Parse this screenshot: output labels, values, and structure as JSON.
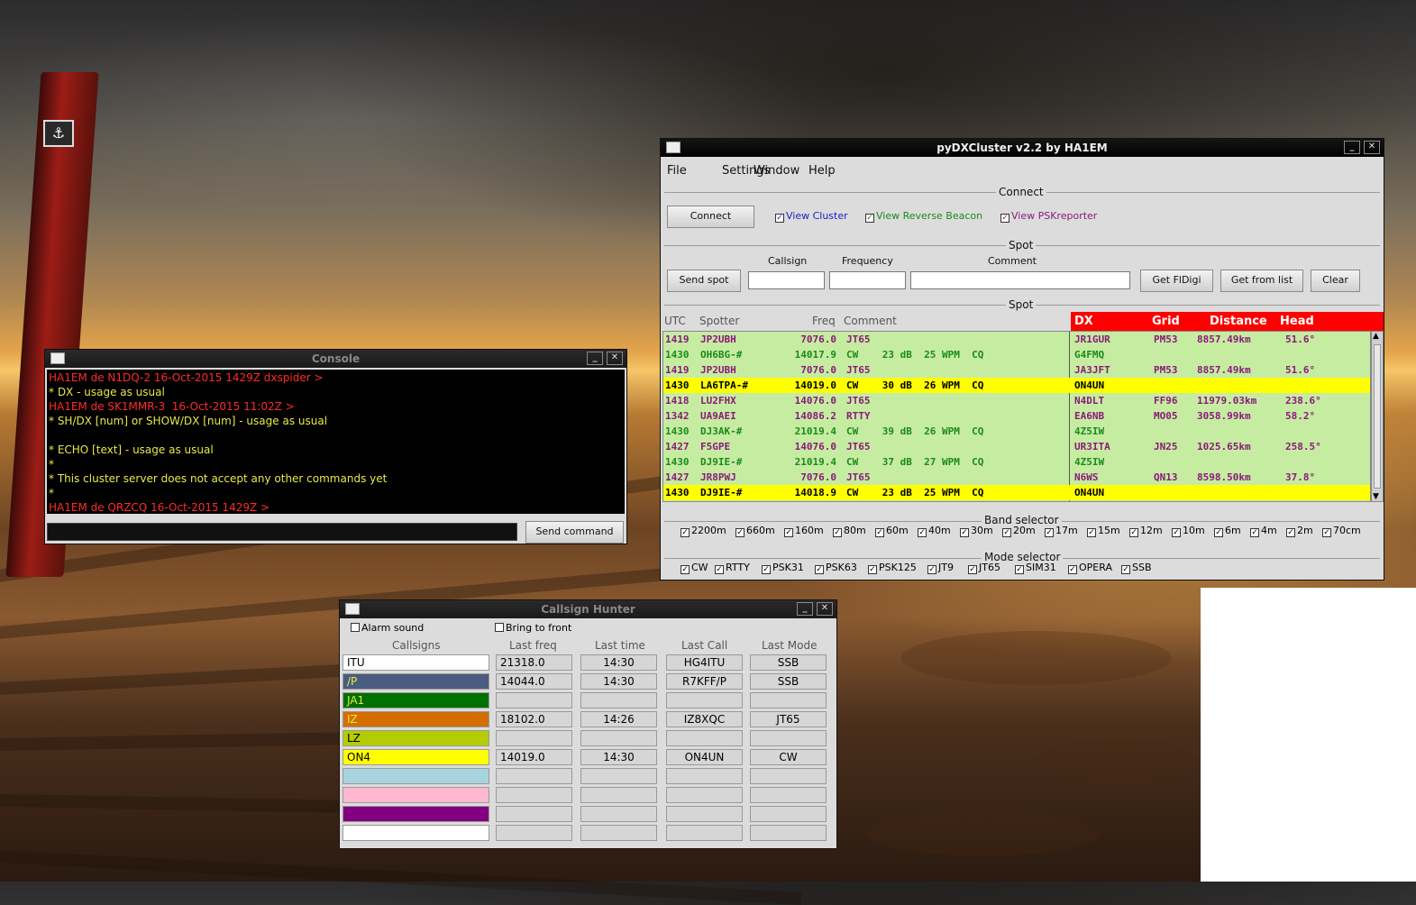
{
  "desktop": {
    "sign_glyph": "⚓"
  },
  "pydx": {
    "title": "pyDXCluster v2.2 by HA1EM",
    "menu": [
      "File",
      "Settings",
      "Window",
      "Help"
    ],
    "connect_group": "Connect",
    "connect_btn": "Connect",
    "view_cluster": "View Cluster",
    "view_beacon": "View Reverse Beacon",
    "view_psk": "View PSKreporter",
    "spot_group": "Spot",
    "send_spot": "Send spot",
    "callsign_label": "Callsign",
    "frequency_label": "Frequency",
    "comment_label": "Comment",
    "get_fldigi": "Get FlDigi",
    "get_from_list": "Get from list",
    "clear": "Clear",
    "spot_list_group": "Spot",
    "headers": {
      "utc": "UTC",
      "spotter": "Spotter",
      "freq": "Freq",
      "comment": "Comment",
      "dx": "DX",
      "grid": "Grid",
      "distance": "Distance",
      "head": "Head"
    },
    "spots": [
      {
        "utc": "1419",
        "spotter": "JP2UBH",
        "freq": "7076.0",
        "comment": "JT65",
        "dx": "JR1GUR",
        "grid": "PM53",
        "distance": "8857.49km",
        "head": "51.6°",
        "color": "#8a1a7a",
        "hl": false
      },
      {
        "utc": "1430",
        "spotter": "OH6BG-#",
        "freq": "14017.9",
        "comment": "CW    23 dB  25 WPM  CQ",
        "dx": "G4FMQ",
        "grid": "",
        "distance": "",
        "head": "",
        "color": "#1b8a1b",
        "hl": false
      },
      {
        "utc": "1419",
        "spotter": "JP2UBH",
        "freq": "7076.0",
        "comment": "JT65",
        "dx": "JA3JFT",
        "grid": "PM53",
        "distance": "8857.49km",
        "head": "51.6°",
        "color": "#8a1a7a",
        "hl": false
      },
      {
        "utc": "1430",
        "spotter": "LA6TPA-#",
        "freq": "14019.0",
        "comment": "CW    30 dB  26 WPM  CQ",
        "dx": "ON4UN",
        "grid": "",
        "distance": "",
        "head": "",
        "color": "#000000",
        "hl": true
      },
      {
        "utc": "1418",
        "spotter": "LU2FHX",
        "freq": "14076.0",
        "comment": "JT65",
        "dx": "N4DLT",
        "grid": "FF96",
        "distance": "11979.03km",
        "head": "238.6°",
        "color": "#8a1a7a",
        "hl": false
      },
      {
        "utc": "1342",
        "spotter": "UA9AEI",
        "freq": "14086.2",
        "comment": "RTTY",
        "dx": "EA6NB",
        "grid": "MO05",
        "distance": "3058.99km",
        "head": "58.2°",
        "color": "#8a1a7a",
        "hl": false
      },
      {
        "utc": "1430",
        "spotter": "DJ3AK-#",
        "freq": "21019.4",
        "comment": "CW    39 dB  26 WPM  CQ",
        "dx": "4Z5IW",
        "grid": "",
        "distance": "",
        "head": "",
        "color": "#1b8a1b",
        "hl": false
      },
      {
        "utc": "1427",
        "spotter": "F5GPE",
        "freq": "14076.0",
        "comment": "JT65",
        "dx": "UR3ITA",
        "grid": "JN25",
        "distance": "1025.65km",
        "head": "258.5°",
        "color": "#8a1a7a",
        "hl": false
      },
      {
        "utc": "1430",
        "spotter": "DJ9IE-#",
        "freq": "21019.4",
        "comment": "CW    37 dB  27 WPM  CQ",
        "dx": "4Z5IW",
        "grid": "",
        "distance": "",
        "head": "",
        "color": "#1b8a1b",
        "hl": false
      },
      {
        "utc": "1427",
        "spotter": "JR8PWJ",
        "freq": "7076.0",
        "comment": "JT65",
        "dx": "N6WS",
        "grid": "QN13",
        "distance": "8598.50km",
        "head": "37.8°",
        "color": "#8a1a7a",
        "hl": false
      },
      {
        "utc": "1430",
        "spotter": "DJ9IE-#",
        "freq": "14018.9",
        "comment": "CW    23 dB  25 WPM  CQ",
        "dx": "ON4UN",
        "grid": "",
        "distance": "",
        "head": "",
        "color": "#000000",
        "hl": true
      }
    ],
    "band_group": "Band selector",
    "bands": [
      "2200m",
      "660m",
      "160m",
      "80m",
      "60m",
      "40m",
      "30m",
      "20m",
      "17m",
      "15m",
      "12m",
      "10m",
      "6m",
      "4m",
      "2m",
      "70cm"
    ],
    "mode_group": "Mode selector",
    "modes": [
      "CW",
      "RTTY",
      "PSK31",
      "PSK63",
      "PSK125",
      "JT9",
      "JT65",
      "SIM31",
      "OPERA",
      "SSB"
    ],
    "colors": {
      "list_bg": "#c6eca2",
      "dx_header": "#ff0000",
      "highlight": "#ffff00"
    }
  },
  "console": {
    "title": "Console",
    "lines": [
      {
        "text": "HA1EM de N1DQ-2 16-Oct-2015 1429Z dxspider >",
        "color": "#ff2a2a"
      },
      {
        "text": "* DX - usage as usual",
        "color": "#e8e84a"
      },
      {
        "text": "HA1EM de SK1MMR-3  16-Oct-2015 11:02Z >",
        "color": "#ff2a2a"
      },
      {
        "text": "* SH/DX [num] or SHOW/DX [num] - usage as usual",
        "color": "#e8e84a"
      },
      {
        "text": "",
        "color": "#e8e84a"
      },
      {
        "text": "* ECHO [text] - usage as usual",
        "color": "#e8e84a"
      },
      {
        "text": "*",
        "color": "#e8e84a"
      },
      {
        "text": "* This cluster server does not accept any other commands yet",
        "color": "#e8e84a"
      },
      {
        "text": "*",
        "color": "#e8e84a"
      },
      {
        "text": "HA1EM de QRZCQ 16-Oct-2015 1429Z >",
        "color": "#ff2a2a"
      }
    ],
    "send_btn": "Send command"
  },
  "hunter": {
    "title": "Callsign Hunter",
    "alarm_sound": "Alarm sound",
    "bring_to_front": "Bring to front",
    "headers": {
      "callsigns": "Callsigns",
      "last_freq": "Last freq",
      "last_time": "Last time",
      "last_call": "Last Call",
      "last_mode": "Last Mode"
    },
    "rows": [
      {
        "call": "ITU",
        "bg": "#ffffff",
        "fg": "#000000",
        "freq": "21318.0",
        "time": "14:30",
        "lastcall": "HG4ITU",
        "mode": "SSB"
      },
      {
        "call": "/P",
        "bg": "#4a5d80",
        "fg": "#e8e84a",
        "freq": "14044.0",
        "time": "14:30",
        "lastcall": "R7KFF/P",
        "mode": "SSB"
      },
      {
        "call": "JA1",
        "bg": "#007000",
        "fg": "#e8e84a",
        "freq": "",
        "time": "",
        "lastcall": "",
        "mode": ""
      },
      {
        "call": "IZ",
        "bg": "#d46d00",
        "fg": "#e8e84a",
        "freq": "18102.0",
        "time": "14:26",
        "lastcall": "IZ8XQC",
        "mode": "JT65"
      },
      {
        "call": "LZ",
        "bg": "#b4cc00",
        "fg": "#000000",
        "freq": "",
        "time": "",
        "lastcall": "",
        "mode": ""
      },
      {
        "call": "ON4",
        "bg": "#ffff00",
        "fg": "#000000",
        "freq": "14019.0",
        "time": "14:30",
        "lastcall": "ON4UN",
        "mode": "CW"
      },
      {
        "call": "",
        "bg": "#a8d4e0",
        "fg": "#000000",
        "freq": "",
        "time": "",
        "lastcall": "",
        "mode": ""
      },
      {
        "call": "",
        "bg": "#ffb8d0",
        "fg": "#000000",
        "freq": "",
        "time": "",
        "lastcall": "",
        "mode": ""
      },
      {
        "call": "",
        "bg": "#800080",
        "fg": "#ffffff",
        "freq": "",
        "time": "",
        "lastcall": "",
        "mode": ""
      },
      {
        "call": "",
        "bg": "#ffffff",
        "fg": "#000000",
        "freq": "",
        "time": "",
        "lastcall": "",
        "mode": ""
      }
    ]
  }
}
